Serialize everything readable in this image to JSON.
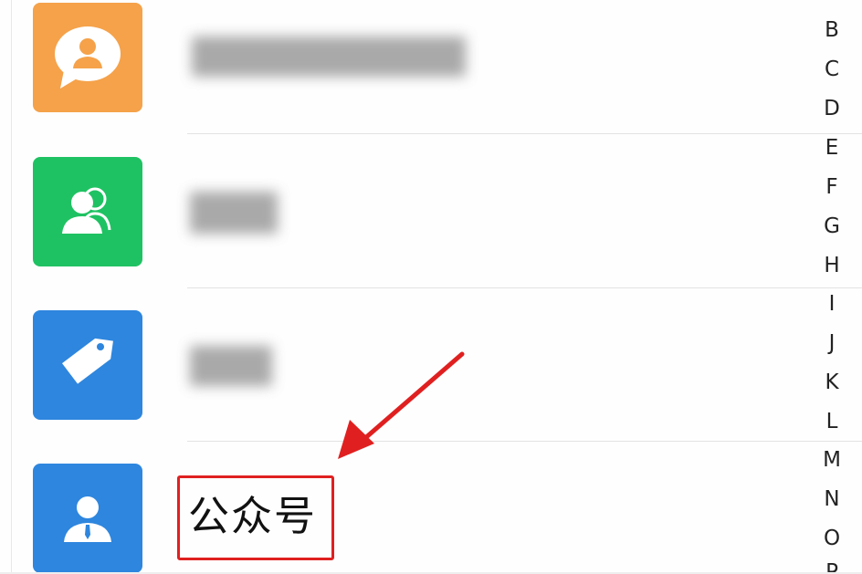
{
  "contacts_list": {
    "rows": [
      {
        "icon": "chat-person-icon",
        "color": "#F5A24A",
        "label": ""
      },
      {
        "icon": "group-icon",
        "color": "#1FC262",
        "label": ""
      },
      {
        "icon": "tag-icon",
        "color": "#2E86DE",
        "label": ""
      },
      {
        "icon": "official-account-icon",
        "color": "#2E86DE",
        "label": "公众号"
      }
    ]
  },
  "index_bar": {
    "letters": [
      "B",
      "C",
      "D",
      "E",
      "F",
      "G",
      "H",
      "I",
      "J",
      "K",
      "L",
      "M",
      "N",
      "O",
      "P"
    ]
  },
  "annotation": {
    "color": "#E02020"
  }
}
